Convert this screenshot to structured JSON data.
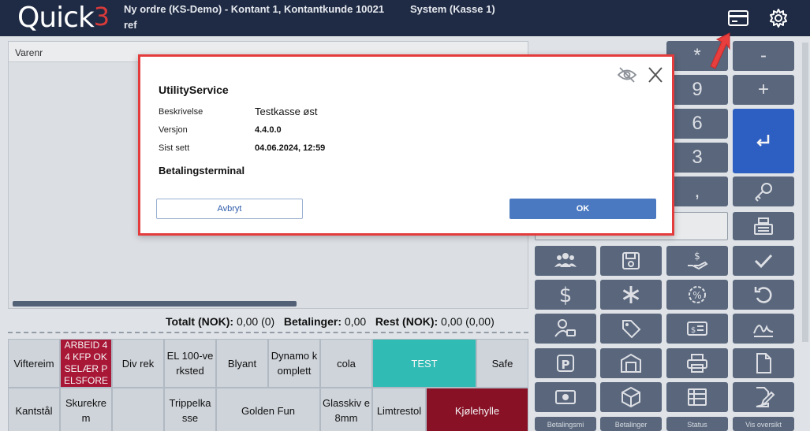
{
  "header": {
    "logo_text": "Quick",
    "logo_super": "3",
    "order_line": "Ny ordre (KS-Demo) - Kontant 1, Kontantkunde 10021",
    "order_line2": "ref",
    "system_line": "System (Kasse 1)",
    "icons": [
      "card-icon",
      "gear-icon"
    ]
  },
  "grid": {
    "column_header": "Varenr"
  },
  "totals": {
    "total_label": "Totalt (NOK):",
    "total_value": "0,00 (0)",
    "payments_label": "Betalinger:",
    "payments_value": "0,00",
    "rest_label": "Rest (NOK):",
    "rest_value": "0,00 (0,00)"
  },
  "tiles": [
    {
      "label": "Viftereim",
      "style": "normal"
    },
    {
      "label": "ARBEID 4 4 KFP OK SELÆR P ELSFORE",
      "style": "red"
    },
    {
      "label": "Div rek",
      "style": "normal"
    },
    {
      "label": "EL 100-ve rksted",
      "style": "normal"
    },
    {
      "label": "Blyant",
      "style": "normal"
    },
    {
      "label": "Dynamo k omplett",
      "style": "normal"
    },
    {
      "label": "cola",
      "style": "normal"
    },
    {
      "label": "TEST",
      "style": "teal"
    },
    {
      "label": "Safe",
      "style": "normal"
    },
    {
      "label": "Kantstål",
      "style": "normal"
    },
    {
      "label": "Skurekre m",
      "style": "normal"
    },
    {
      "label": "",
      "style": "normal"
    },
    {
      "label": "Trippelka sse",
      "style": "normal"
    },
    {
      "label": "Golden Fun",
      "style": "normal"
    },
    {
      "label": "Glasskiv e 8mm",
      "style": "normal"
    },
    {
      "label": "Limtrestol",
      "style": "normal"
    },
    {
      "label": "Kjølehylle",
      "style": "darkred"
    }
  ],
  "keypad": {
    "keys": [
      "*",
      "-",
      "9",
      "+",
      "6",
      "3",
      ","
    ],
    "bottom_labels": [
      "Betalingsmi",
      "Betalinger",
      "Status",
      "Vis oversikt"
    ]
  },
  "modal": {
    "title": "UtilityService",
    "rows": [
      {
        "label": "Beskrivelse",
        "value": "Testkasse øst"
      },
      {
        "label": "Versjon",
        "value": "4.4.0.0"
      },
      {
        "label": "Sist sett",
        "value": "04.06.2024, 12:59"
      }
    ],
    "section_title": "Betalingsterminal",
    "cancel_label": "Avbryt",
    "ok_label": "OK"
  },
  "colors": {
    "header_bg": "#1f2b44",
    "key_bg": "#5d6b82",
    "enter_key": "#2f62c9",
    "modal_border": "#e43c3c",
    "ok_button": "#4a79c2"
  }
}
